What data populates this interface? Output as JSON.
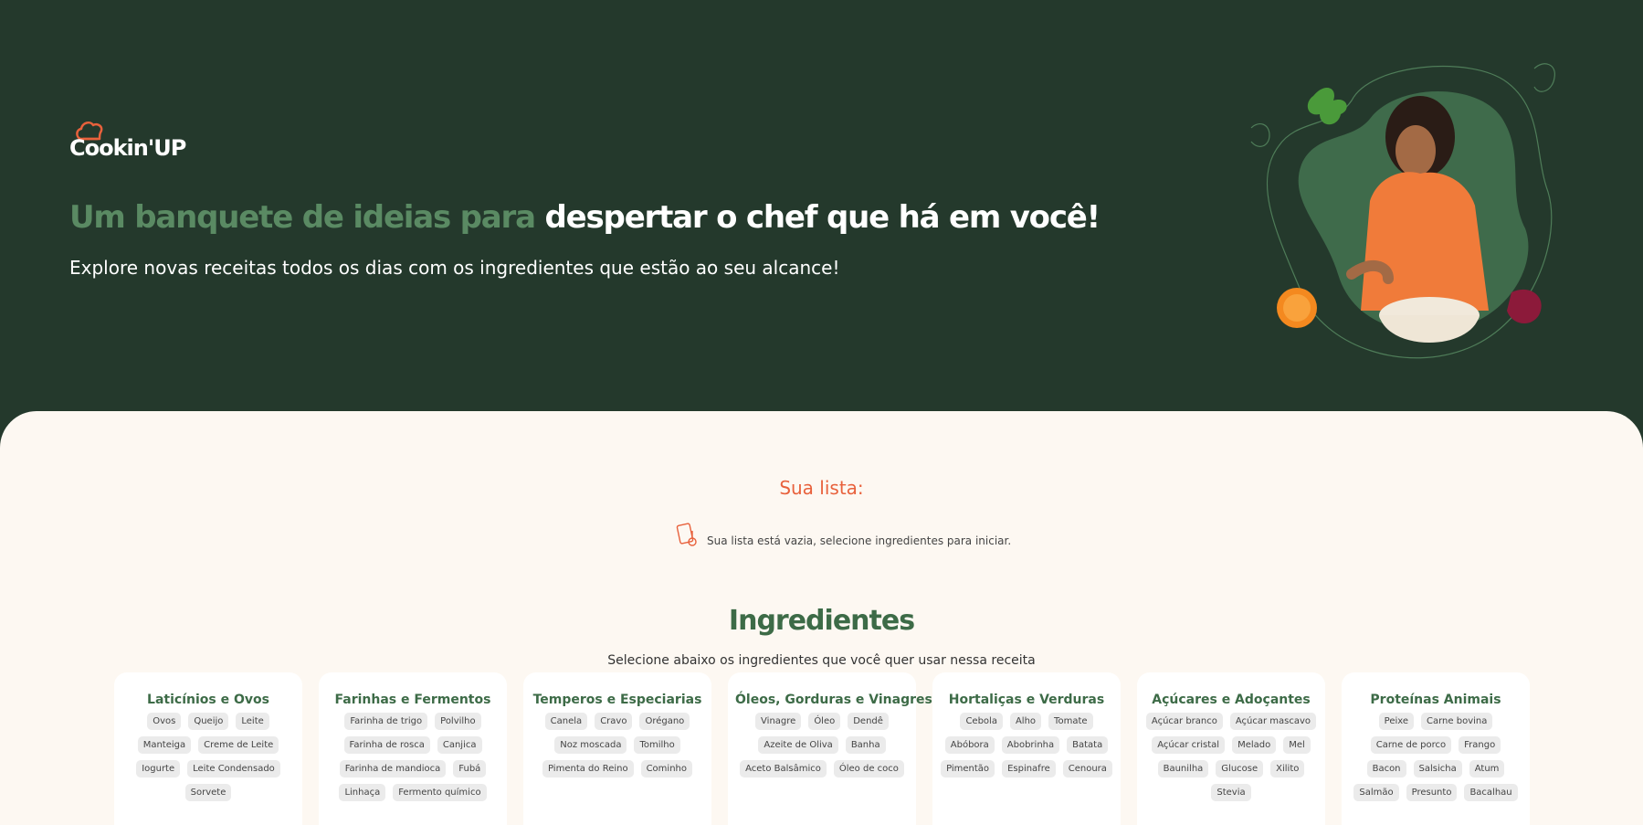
{
  "logo": {
    "text": "Cookin'UP"
  },
  "hero": {
    "title_muted": "Um banquete de ideias para",
    "title_bright": "despertar o chef que há em você!",
    "subtitle": "Explore novas receitas todos os dias com os ingredientes que estão ao seu alcance!"
  },
  "list": {
    "title": "Sua lista:",
    "empty_message": "Sua lista está vazia, selecione ingredientes para iniciar."
  },
  "ingredients": {
    "title": "Ingredientes",
    "subtitle": "Selecione abaixo os ingredientes que você quer usar nessa receita",
    "categories": [
      {
        "name": "Laticínios e Ovos",
        "items": [
          "Ovos",
          "Queijo",
          "Leite",
          "Manteiga",
          "Creme de Leite",
          "Iogurte",
          "Leite Condensado",
          "Sorvete"
        ]
      },
      {
        "name": "Farinhas e Fermentos",
        "items": [
          "Farinha de trigo",
          "Polvilho",
          "Farinha de rosca",
          "Canjica",
          "Farinha de mandioca",
          "Fubá",
          "Linhaça",
          "Fermento químico"
        ]
      },
      {
        "name": "Temperos e Especiarias",
        "items": [
          "Canela",
          "Cravo",
          "Orégano",
          "Noz moscada",
          "Tomilho",
          "Pimenta do Reino",
          "Cominho"
        ]
      },
      {
        "name": "Óleos, Gorduras e Vinagres",
        "items": [
          "Vinagre",
          "Óleo",
          "Dendê",
          "Azeite de Oliva",
          "Banha",
          "Aceto Balsâmico",
          "Óleo de coco"
        ]
      },
      {
        "name": "Hortaliças e Verduras",
        "items": [
          "Cebola",
          "Alho",
          "Tomate",
          "Abóbora",
          "Abobrinha",
          "Batata",
          "Pimentão",
          "Espinafre",
          "Cenoura"
        ]
      },
      {
        "name": "Açúcares e Adoçantes",
        "items": [
          "Açúcar branco",
          "Açúcar mascavo",
          "Açúcar cristal",
          "Melado",
          "Mel",
          "Baunilha",
          "Glucose",
          "Xilito",
          "Stevia"
        ]
      },
      {
        "name": "Proteínas Animais",
        "items": [
          "Peixe",
          "Carne bovina",
          "Carne de porco",
          "Frango",
          "Bacon",
          "Salsicha",
          "Atum",
          "Salmão",
          "Presunto",
          "Bacalhau"
        ]
      }
    ]
  },
  "colors": {
    "hero_bg": "#24392c",
    "content_bg": "#fdf8f2",
    "accent_orange": "#e8613c",
    "accent_green": "#3d6b47",
    "muted_green": "#5a8a63"
  },
  "icons": [
    "chef-hat-icon",
    "empty-list-icon"
  ]
}
